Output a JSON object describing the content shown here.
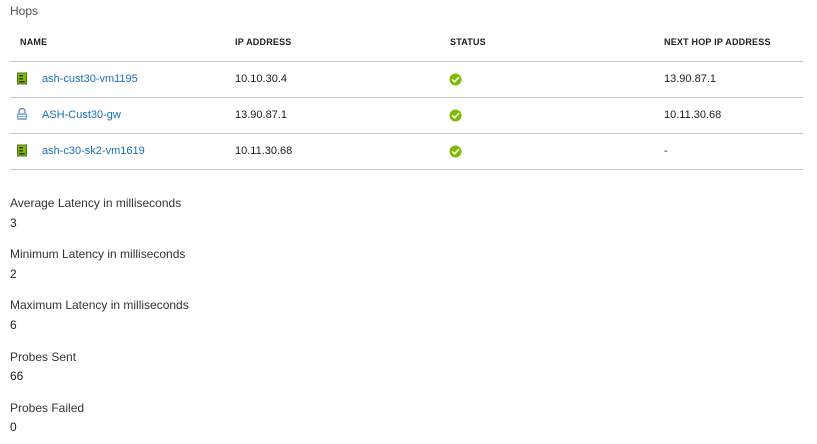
{
  "section": {
    "title": "Hops"
  },
  "table": {
    "headers": {
      "name": "NAME",
      "ip_address": "IP ADDRESS",
      "status": "STATUS",
      "next_hop": "NEXT HOP IP ADDRESS"
    },
    "rows": [
      {
        "icon": "vm-icon",
        "name": "ash-cust30-vm1195",
        "ip": "10.10.30.4",
        "status": "ok",
        "next_hop": "13.90.87.1"
      },
      {
        "icon": "gateway-icon",
        "name": "ASH-Cust30-gw",
        "ip": "13.90.87.1",
        "status": "ok",
        "next_hop": "10.11.30.68"
      },
      {
        "icon": "vm-icon",
        "name": "ash-c30-sk2-vm1619",
        "ip": "10.11.30.68",
        "status": "ok",
        "next_hop": "-"
      }
    ]
  },
  "metrics": [
    {
      "label": "Average Latency in milliseconds",
      "value": "3"
    },
    {
      "label": "Minimum Latency in milliseconds",
      "value": "2"
    },
    {
      "label": "Maximum Latency in milliseconds",
      "value": "6"
    },
    {
      "label": "Probes Sent",
      "value": "66"
    },
    {
      "label": "Probes Failed",
      "value": "0"
    }
  ],
  "colors": {
    "link": "#1a6fb5",
    "status_ok": "#7fba00",
    "divider": "#c8c8c8"
  }
}
